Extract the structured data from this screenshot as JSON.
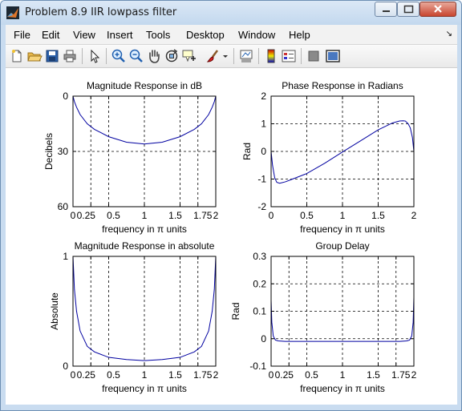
{
  "window": {
    "title": "Problem 8.9 IIR lowpass filter"
  },
  "menu": [
    "File",
    "Edit",
    "View",
    "Insert",
    "Tools",
    "Desktop",
    "Window",
    "Help"
  ],
  "toolbar": {
    "buttons": [
      "new-figure",
      "open-file",
      "save",
      "print",
      "edit-plot",
      "zoom-in",
      "zoom-out",
      "pan",
      "rotate-3d",
      "data-cursor",
      "brush",
      "link-plot",
      "colorbar",
      "legend",
      "hide-plot-tools",
      "show-plot-tools"
    ]
  },
  "chart_data": [
    {
      "type": "line",
      "title": "Magnitude Response in dB",
      "xlabel": "frequency in π units",
      "ylabel": "Decibels",
      "xlim": [
        0,
        2
      ],
      "ylim": [
        0,
        60
      ],
      "y_reversed": true,
      "xticks": [
        0,
        0.25,
        0.5,
        1,
        1.5,
        1.75,
        2
      ],
      "xtick_labels": [
        "0",
        "0.25",
        "0.5",
        "1",
        "1.5",
        "1.75",
        "2"
      ],
      "yticks": [
        0,
        30,
        60
      ],
      "ytick_labels": [
        "0",
        "30",
        "60"
      ],
      "grid": true,
      "color": "#0000a0",
      "series": [
        {
          "x": [
            0,
            0.02,
            0.05,
            0.1,
            0.2,
            0.3,
            0.5,
            0.75,
            1,
            1.25,
            1.5,
            1.7,
            1.8,
            1.9,
            1.95,
            1.98,
            2
          ],
          "values": [
            0,
            3,
            6,
            10,
            15,
            18,
            22,
            25,
            26,
            25,
            22,
            18,
            15,
            10,
            6,
            3,
            0
          ]
        }
      ]
    },
    {
      "type": "line",
      "title": "Phase Response in Radians",
      "xlabel": "frequency in π units",
      "ylabel": "Rad",
      "xlim": [
        0,
        2
      ],
      "ylim": [
        -2,
        2
      ],
      "xticks": [
        0,
        0.5,
        1,
        1.5,
        2
      ],
      "xtick_labels": [
        "0",
        "0.5",
        "1",
        "1.5",
        "2"
      ],
      "yticks": [
        -2,
        -1,
        0,
        1,
        2
      ],
      "ytick_labels": [
        "-2",
        "-1",
        "0",
        "1",
        "2"
      ],
      "grid": true,
      "color": "#0000a0",
      "series": [
        {
          "x": [
            0,
            0.02,
            0.05,
            0.08,
            0.12,
            0.2,
            0.3,
            0.5,
            0.75,
            1,
            1.25,
            1.5,
            1.7,
            1.8,
            1.85,
            1.88,
            1.92,
            1.95,
            1.98,
            2
          ],
          "values": [
            0,
            -0.5,
            -0.95,
            -1.12,
            -1.15,
            -1.1,
            -1.0,
            -0.8,
            -0.43,
            -0.02,
            0.38,
            0.78,
            1.03,
            1.1,
            1.11,
            1.1,
            1.0,
            0.85,
            0.5,
            0
          ]
        }
      ]
    },
    {
      "type": "line",
      "title": "Magnitude Response in absolute",
      "xlabel": "frequency in π units",
      "ylabel": "Absolute",
      "xlim": [
        0,
        2
      ],
      "ylim": [
        0,
        1
      ],
      "xticks": [
        0,
        0.25,
        0.5,
        1,
        1.5,
        1.75,
        2
      ],
      "xtick_labels": [
        "0",
        "0.25",
        "0.5",
        "1",
        "1.5",
        "1.75",
        "2"
      ],
      "yticks": [
        0,
        1
      ],
      "ytick_labels": [
        "0",
        "1"
      ],
      "grid": true,
      "color": "#0000a0",
      "series": [
        {
          "x": [
            0,
            0.02,
            0.05,
            0.1,
            0.2,
            0.3,
            0.5,
            0.75,
            1,
            1.25,
            1.5,
            1.7,
            1.8,
            1.9,
            1.95,
            1.98,
            2
          ],
          "values": [
            1,
            0.7,
            0.5,
            0.32,
            0.18,
            0.13,
            0.08,
            0.06,
            0.05,
            0.06,
            0.08,
            0.13,
            0.18,
            0.32,
            0.5,
            0.7,
            1
          ]
        }
      ]
    },
    {
      "type": "line",
      "title": "Group Delay",
      "xlabel": "frequency in π units",
      "ylabel": "Rad",
      "xlim": [
        0,
        2
      ],
      "ylim": [
        -0.1,
        0.3
      ],
      "xticks": [
        0,
        0.25,
        0.5,
        1,
        1.5,
        1.75,
        2
      ],
      "xtick_labels": [
        "0",
        "0.25",
        "0.5",
        "1",
        "1.5",
        "1.75",
        "2"
      ],
      "yticks": [
        -0.1,
        0,
        0.1,
        0.2,
        0.3
      ],
      "ytick_labels": [
        "-0.1",
        "0",
        "0.1",
        "0.2",
        "0.3"
      ],
      "grid": true,
      "color": "#0000a0",
      "series": [
        {
          "x": [
            0,
            0.01,
            0.03,
            0.06,
            0.1,
            0.2,
            0.5,
            1,
            1.5,
            1.8,
            1.9,
            1.94,
            1.97,
            1.99,
            2
          ],
          "values": [
            0.14,
            0.06,
            0.01,
            -0.005,
            -0.008,
            -0.01,
            -0.01,
            -0.01,
            -0.01,
            -0.01,
            -0.008,
            -0.005,
            0.01,
            0.06,
            0.15
          ]
        }
      ]
    }
  ]
}
